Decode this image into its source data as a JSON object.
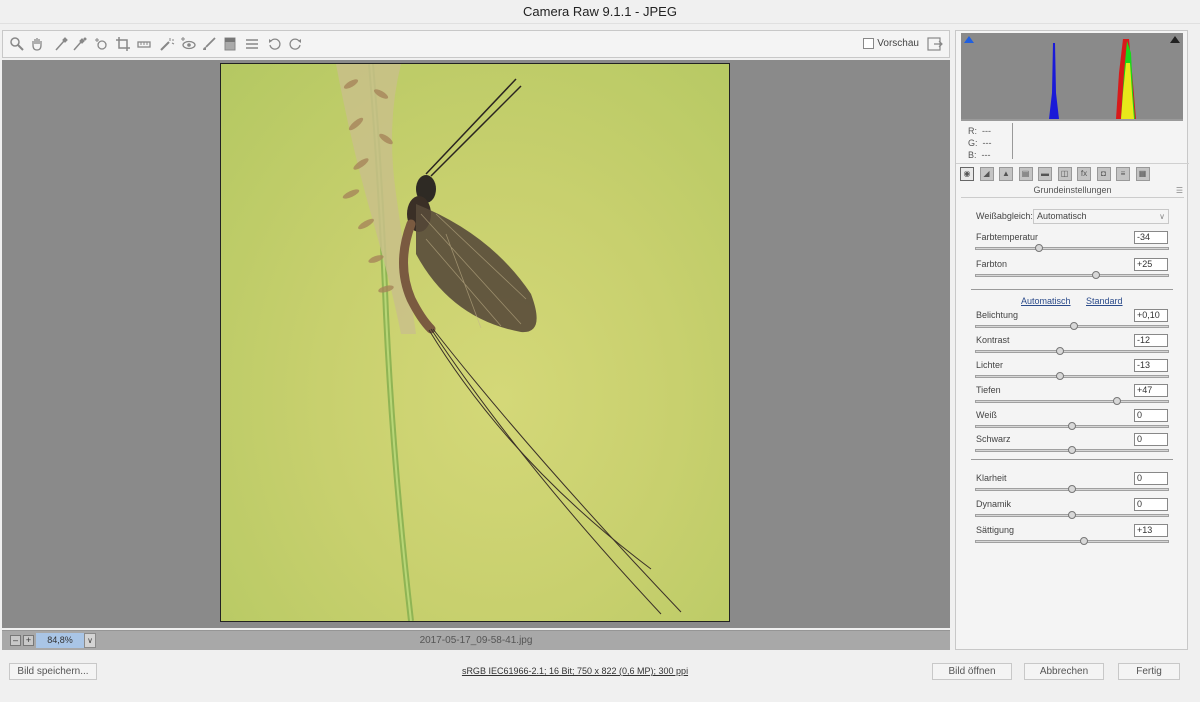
{
  "window": {
    "title": "Camera Raw 9.1.1 - JPEG"
  },
  "toolbar": {
    "tools": [
      {
        "name": "zoom-icon"
      },
      {
        "name": "hand-icon"
      },
      {
        "name": "white-balance-icon"
      },
      {
        "name": "color-sampler-icon"
      },
      {
        "name": "targeted-adjustment-icon"
      },
      {
        "name": "crop-icon"
      },
      {
        "name": "straighten-icon"
      },
      {
        "name": "spot-removal-icon"
      },
      {
        "name": "red-eye-icon"
      },
      {
        "name": "adjustment-brush-icon"
      },
      {
        "name": "graduated-filter-icon"
      },
      {
        "name": "presets-list-icon"
      },
      {
        "name": "rotate-left-icon"
      },
      {
        "name": "rotate-right-icon"
      }
    ],
    "preview_label": "Vorschau"
  },
  "status": {
    "zoom_minus": "–",
    "zoom_plus": "+",
    "zoom_value": "84,8%",
    "zoom_dropdown": "∨",
    "filename": "2017-05-17_09-58-41.jpg"
  },
  "histogram": {
    "r_label": "R:",
    "r_value": "---",
    "g_label": "G:",
    "g_value": "---",
    "b_label": "B:",
    "b_value": "---"
  },
  "panel": {
    "title": "Grundeinstellungen",
    "tabs": [
      {
        "name": "tab-basic-icon",
        "glyph": "◉"
      },
      {
        "name": "tab-tone-curve-icon",
        "glyph": "◢"
      },
      {
        "name": "tab-detail-icon",
        "glyph": "▲"
      },
      {
        "name": "tab-hsl-icon",
        "glyph": "▤"
      },
      {
        "name": "tab-split-toning-icon",
        "glyph": "▬"
      },
      {
        "name": "tab-lens-icon",
        "glyph": "◫"
      },
      {
        "name": "tab-effects-icon",
        "glyph": "fx"
      },
      {
        "name": "tab-camera-calibration-icon",
        "glyph": "◘"
      },
      {
        "name": "tab-presets-icon",
        "glyph": "≡"
      },
      {
        "name": "tab-snapshots-icon",
        "glyph": "▦"
      }
    ],
    "white_balance": {
      "label": "Weißabgleich:",
      "value": "Automatisch"
    },
    "auto_link": "Automatisch",
    "default_link": "Standard",
    "sliders": [
      {
        "id": "farbtemperatur",
        "label": "Farbtemperatur",
        "value": "-34",
        "level": 0.33
      },
      {
        "id": "farbton",
        "label": "Farbton",
        "value": "+25",
        "level": 0.625
      },
      {
        "id": "belichtung",
        "label": "Belichtung",
        "value": "+0,10",
        "level": 0.51
      },
      {
        "id": "kontrast",
        "label": "Kontrast",
        "value": "-12",
        "level": 0.44
      },
      {
        "id": "lichter",
        "label": "Lichter",
        "value": "-13",
        "level": 0.435
      },
      {
        "id": "tiefen",
        "label": "Tiefen",
        "value": "+47",
        "level": 0.735
      },
      {
        "id": "weiss",
        "label": "Weiß",
        "value": "0",
        "level": 0.5
      },
      {
        "id": "schwarz",
        "label": "Schwarz",
        "value": "0",
        "level": 0.5
      },
      {
        "id": "klarheit",
        "label": "Klarheit",
        "value": "0",
        "level": 0.5
      },
      {
        "id": "dynamik",
        "label": "Dynamik",
        "value": "0",
        "level": 0.5
      },
      {
        "id": "saettigung",
        "label": "Sättigung",
        "value": "+13",
        "level": 0.565
      }
    ]
  },
  "footer": {
    "save_label": "Bild speichern...",
    "info": "sRGB IEC61966-2.1; 16 Bit; 750 x 822 (0,6 MP); 300 ppi",
    "open_label": "Bild öffnen",
    "cancel_label": "Abbrechen",
    "done_label": "Fertig"
  },
  "colors": {
    "accent": "#2060e0",
    "photo_bg": "#c8d06e",
    "canvas_bg": "#8a8a8a"
  }
}
